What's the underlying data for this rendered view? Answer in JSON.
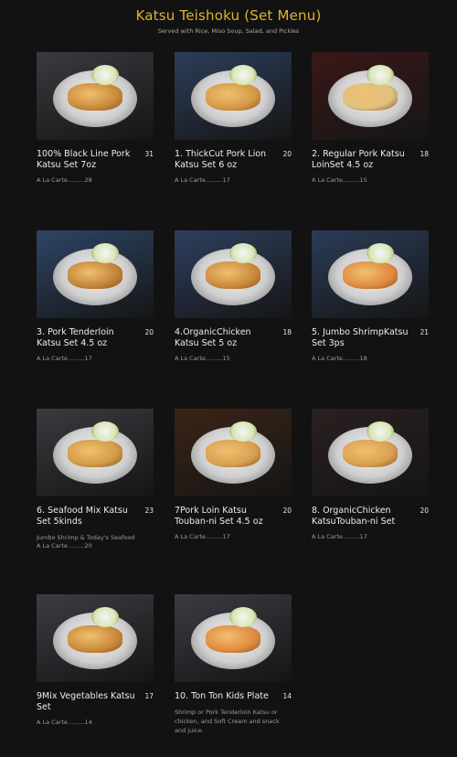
{
  "header": {
    "title": "Katsu Teishoku (Set Menu)",
    "subtitle": "Served with Rice, Miso Soup, Salad, and Pickles"
  },
  "items": [
    {
      "name": "100% Black Line Pork Katsu Set 7oz",
      "price": "31",
      "alacarte": "A La Carte.........28",
      "desc": "",
      "bg": "#3a3a40",
      "accent": "#c98a3a"
    },
    {
      "name": "1. ThickCut Pork Lion Katsu Set 6 oz",
      "price": "20",
      "alacarte": "A La Carte.........17",
      "desc": "",
      "bg": "#2c3e5a",
      "accent": "#d49a44"
    },
    {
      "name": "2. Regular Pork Katsu LoinSet 4.5 oz",
      "price": "18",
      "alacarte": "A La Carte.........15",
      "desc": "",
      "bg": "#3a1818",
      "accent": "#e0c080"
    },
    {
      "name": "3. Pork Tenderloin Katsu Set 4.5 oz",
      "price": "20",
      "alacarte": "A La Carte.........17",
      "desc": "",
      "bg": "#2e4565",
      "accent": "#c2843a"
    },
    {
      "name": "4.OrganicChicken Katsu Set 5 oz",
      "price": "18",
      "alacarte": "A La Carte.........15",
      "desc": "",
      "bg": "#2e3f5e",
      "accent": "#c98a3a"
    },
    {
      "name": "5. Jumbo ShrimpKatsu Set 3ps",
      "price": "21",
      "alacarte": "A La Carte.........18",
      "desc": "",
      "bg": "#2b3c58",
      "accent": "#e08a40"
    },
    {
      "name": "6. Seafood Mix Katsu Set 5kinds",
      "price": "23",
      "alacarte": "A La Carte.........20",
      "desc": "Jumbo Shrimp & Today's Seafood",
      "bg": "#3a3a40",
      "accent": "#d29a48"
    },
    {
      "name": "7Pork Loin Katsu Touban-ni Set 4.5 oz",
      "price": "20",
      "alacarte": "A La Carte.........17",
      "desc": "",
      "bg": "#3a2416",
      "accent": "#d8a050"
    },
    {
      "name": "8. OrganicChicken KatsuTouban-ni Set",
      "price": "20",
      "alacarte": "A La Carte.........17",
      "desc": "",
      "bg": "#2a2020",
      "accent": "#d8a050"
    },
    {
      "name": "9Mix Vegetables Katsu Set",
      "price": "17",
      "alacarte": "A La Carte.........14",
      "desc": "",
      "bg": "#3c3c44",
      "accent": "#c98a3a"
    },
    {
      "name": "10. Ton Ton Kids Plate",
      "price": "14",
      "alacarte": "",
      "desc": "Shrimp or Pork Tenderloin Katsu or chicken, and Soft Cream and snack and juice.",
      "bg": "#3b3b44",
      "accent": "#e08a40"
    }
  ]
}
